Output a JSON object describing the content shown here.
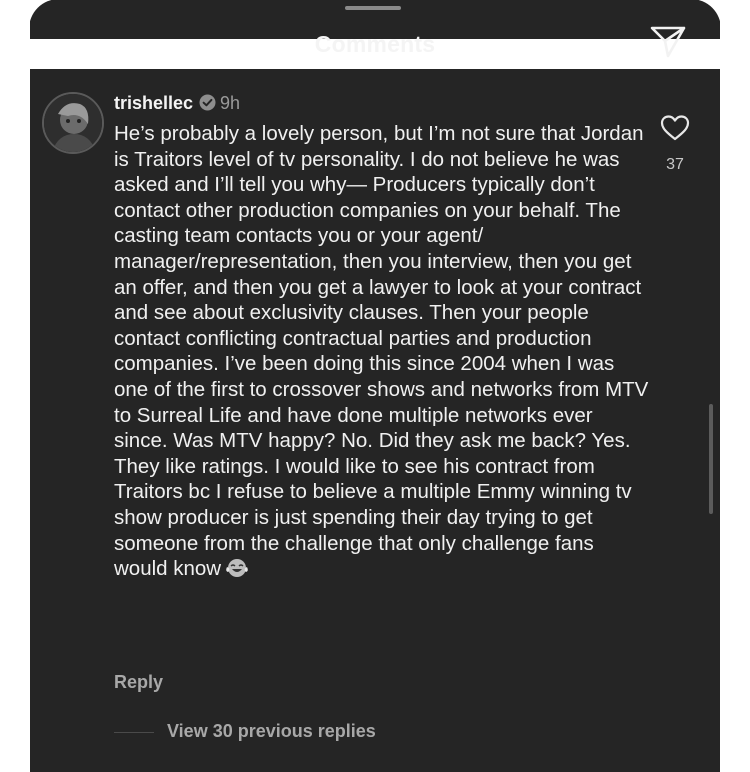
{
  "header": {
    "title": "Comments",
    "send_icon": "send-icon"
  },
  "comment": {
    "username": "trishellec",
    "verified_icon": "verified-badge-icon",
    "time": "9h",
    "text": "He’s probably a lovely person, but I’m not sure that Jordan is Traitors level of tv personality. I do not believe he was asked and I’ll tell you why— Producers typically don’t contact other production companies on your behalf. The casting team contacts you or your agent/ manager/representation, then you interview, then you get an offer, and then you get a lawyer to look at your contract and see about exclusivity clauses. Then your people contact conflicting contractual parties and production companies. I’ve been doing this since 2004 when I was one of the first to crossover shows and networks from MTV to Surreal Life and have done multiple networks ever since. Was MTV happy? No. Did they ask me back? Yes. They like ratings. I would like to see his contract from Traitors bc I refuse to believe a multiple Emmy winning tv show producer is just spending their day trying to get someone from the challenge that only challenge fans would know",
    "emoji": "tears-of-joy-emoji",
    "reply_label": "Reply",
    "like_count": "37",
    "like_icon": "heart-icon"
  },
  "replies": {
    "view_label": "View 30 previous replies"
  }
}
